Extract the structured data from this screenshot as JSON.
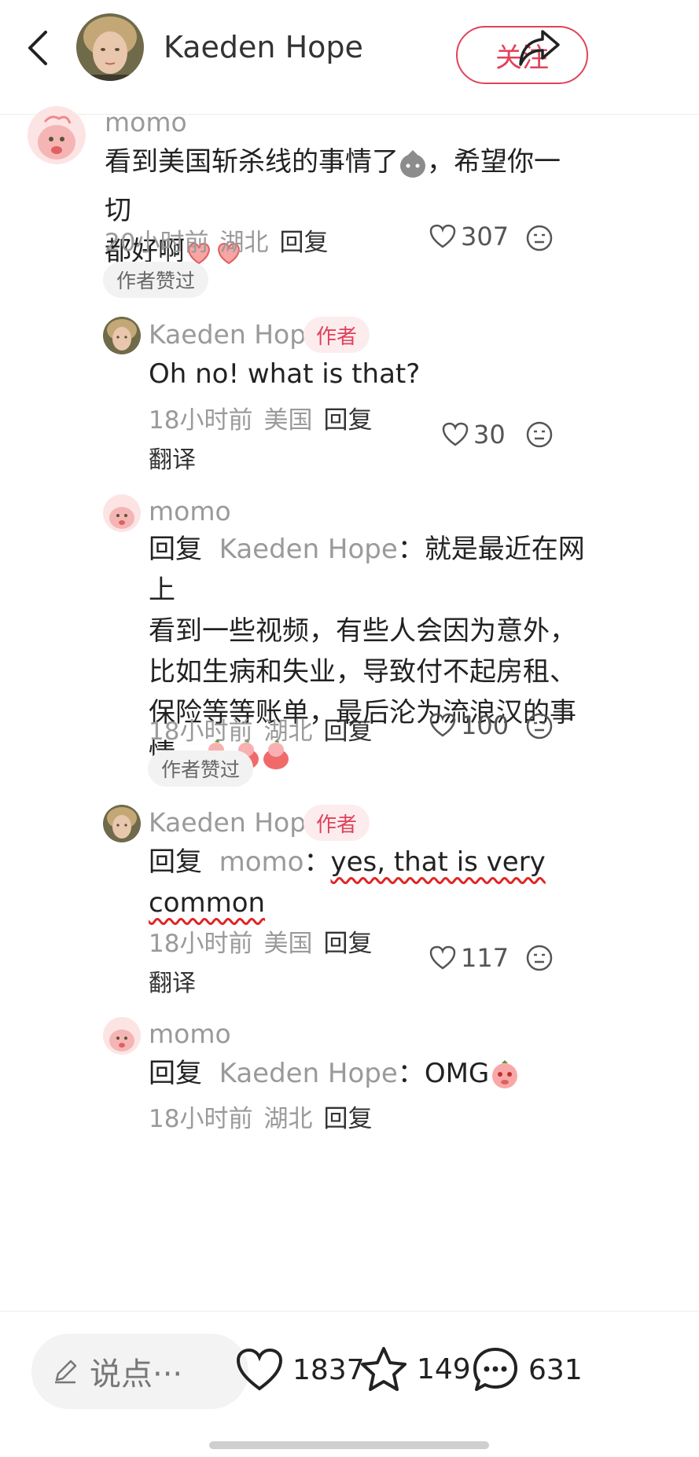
{
  "header": {
    "author_name": "Kaeden Hope",
    "follow_label": "关注",
    "icons": {
      "back": "chevron-left-icon",
      "share": "share-arrow-icon"
    }
  },
  "comments": [
    {
      "user": "momo",
      "text": "看到美国斩杀线的事情了",
      "text_tail": "，希望你一切",
      "text_line2": "都好啊",
      "time": "20小时前",
      "location": "湖北",
      "reply": "回复",
      "likes": "307",
      "badge": "作者赞过"
    },
    {
      "user": "Kaeden Hope",
      "author_tag": "作者",
      "text": "Oh no! what is that?",
      "time": "18小时前",
      "location": "美国",
      "reply": "回复",
      "likes": "30",
      "translate": "翻译"
    },
    {
      "user": "momo",
      "reply_prefix": "回复",
      "reply_to": "Kaeden Hope",
      "reply_colon": "：",
      "line1": "就是最近在网上",
      "line2": "看到一些视频，有些人会因为意外，",
      "line3": "比如生病和失业，导致付不起房租、",
      "line4": "保险等等账单，最后沦为流浪汉的事",
      "line5": "情。",
      "time": "18小时前",
      "location": "湖北",
      "reply": "回复",
      "likes": "100",
      "badge": "作者赞过"
    },
    {
      "user": "Kaeden Hope",
      "author_tag": "作者",
      "reply_prefix": "回复",
      "reply_to": "momo",
      "reply_colon": "：",
      "line1": "yes, that is very",
      "line2": "common",
      "time": "18小时前",
      "location": "美国",
      "reply": "回复",
      "likes": "117",
      "translate": "翻译"
    },
    {
      "user": "momo",
      "reply_prefix": "回复",
      "reply_to": "Kaeden Hope",
      "reply_colon": "：",
      "text": "OMG",
      "time_partial": "18小时前",
      "location_partial": "湖北",
      "reply_partial": "回复"
    }
  ],
  "bottom": {
    "input_placeholder": "说点···",
    "likes": "1837",
    "stars": "149",
    "comments": "631"
  },
  "colors": {
    "accent": "#e0425a",
    "muted": "#9a9a9a",
    "underline": "#e02424"
  }
}
